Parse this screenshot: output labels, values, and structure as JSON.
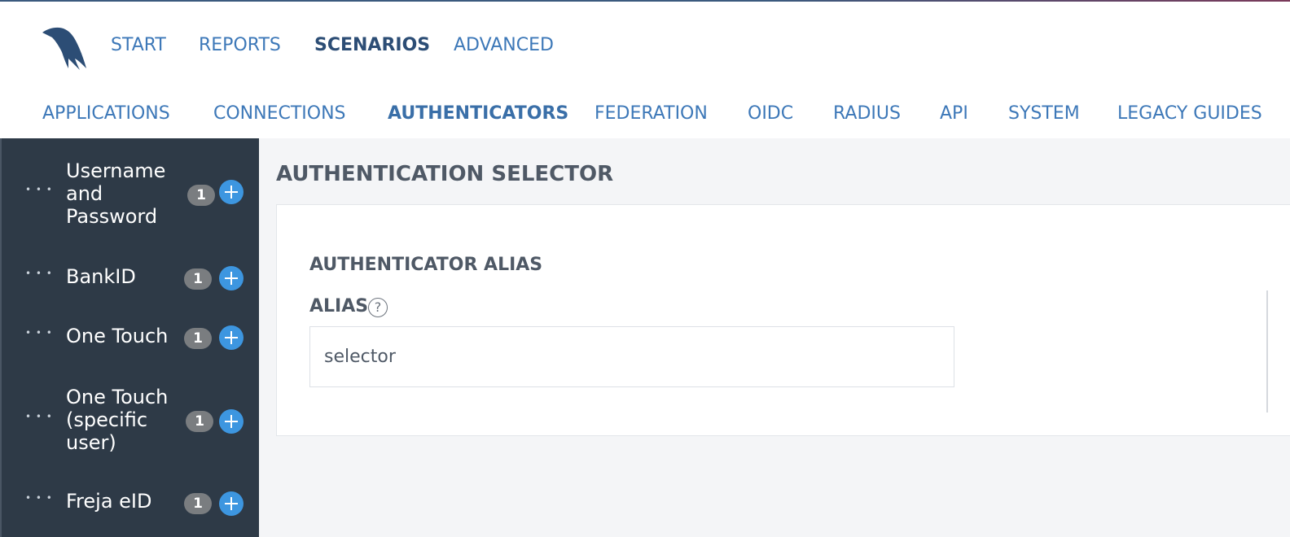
{
  "topnav": {
    "items": [
      {
        "label": "START",
        "active": false
      },
      {
        "label": "REPORTS",
        "active": false
      },
      {
        "label": "SCENARIOS",
        "active": true
      },
      {
        "label": "ADVANCED",
        "active": false
      }
    ]
  },
  "subnav": {
    "items": [
      {
        "label": "APPLICATIONS",
        "active": false
      },
      {
        "label": "CONNECTIONS",
        "active": false
      },
      {
        "label": "AUTHENTICATORS",
        "active": true
      },
      {
        "label": "FEDERATION",
        "active": false
      },
      {
        "label": "OIDC",
        "active": false
      },
      {
        "label": "RADIUS",
        "active": false
      },
      {
        "label": "API",
        "active": false
      },
      {
        "label": "SYSTEM",
        "active": false
      },
      {
        "label": "LEGACY GUIDES",
        "active": false
      }
    ]
  },
  "sidebar": {
    "items": [
      {
        "label": "Username and Password",
        "count": "1"
      },
      {
        "label": "BankID",
        "count": "1"
      },
      {
        "label": "One Touch",
        "count": "1"
      },
      {
        "label": "One Touch (specific user)",
        "count": "1"
      },
      {
        "label": "Freja eID",
        "count": "1"
      }
    ]
  },
  "main": {
    "title": "AUTHENTICATION SELECTOR",
    "section_title": "AUTHENTICATOR ALIAS",
    "alias_label": "ALIAS",
    "help_glyph": "?",
    "alias_value": "selector"
  },
  "colors": {
    "link": "#3d78b8",
    "sidebar_bg": "#2e3a47",
    "add_button": "#3d96e0",
    "badge": "#7a7d80"
  }
}
